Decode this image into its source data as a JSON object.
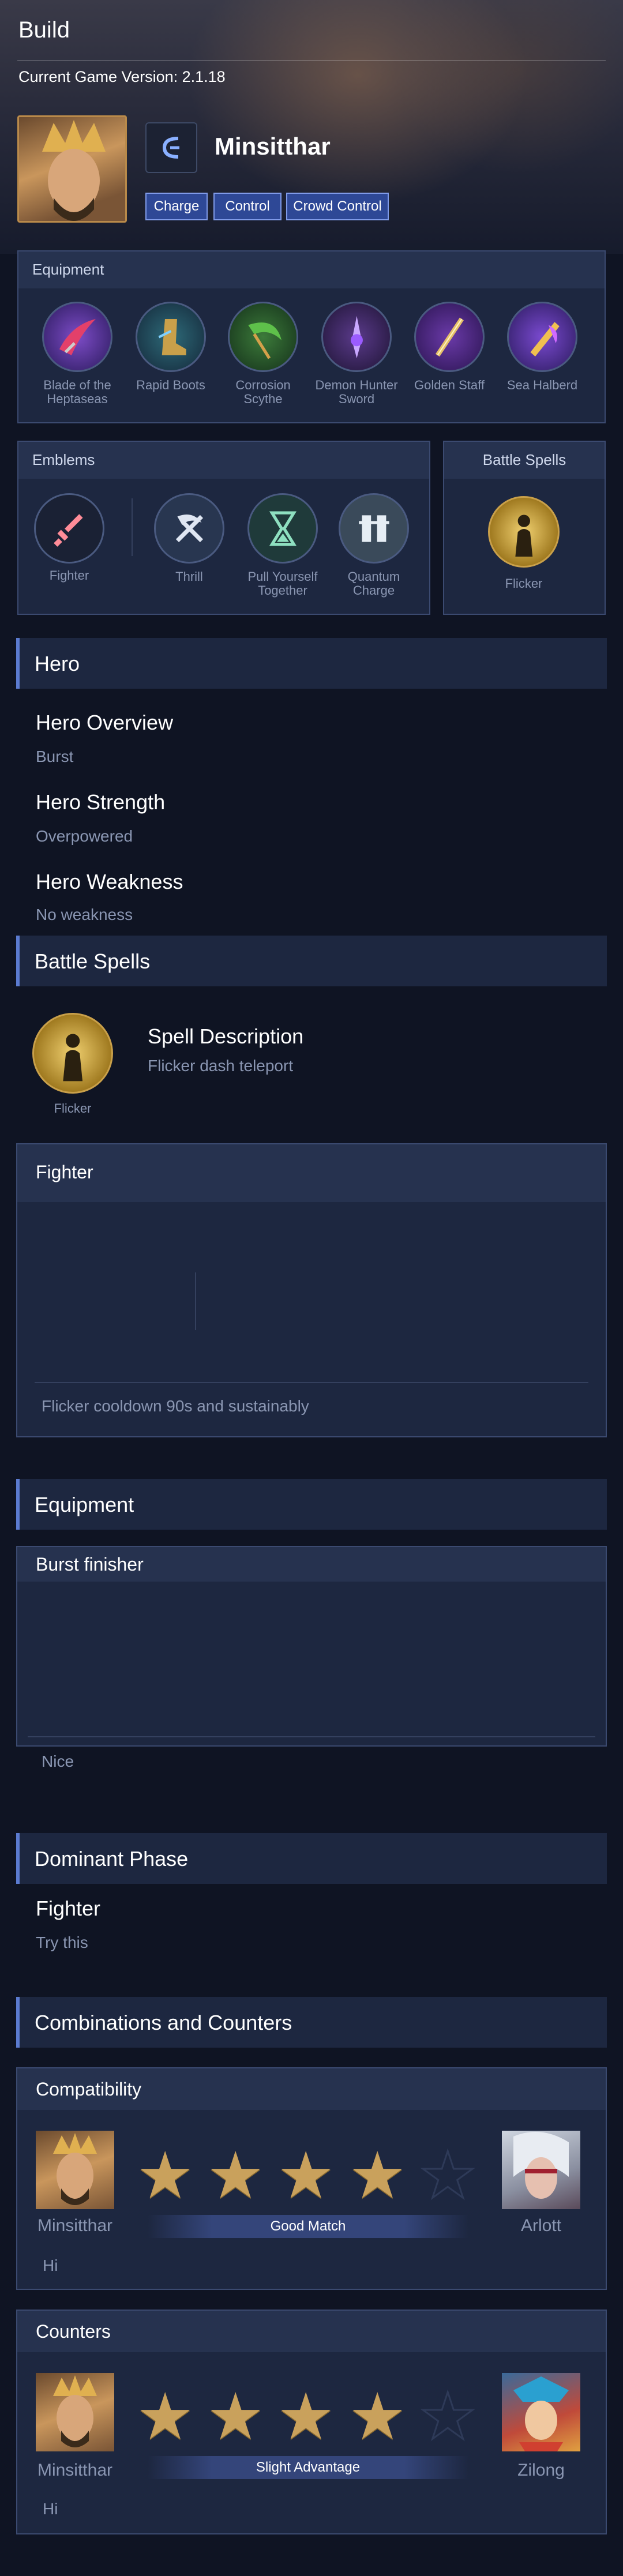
{
  "header": {
    "title": "Build",
    "version": "Current Game Version: 2.1.18"
  },
  "hero": {
    "name": "Minsitthar",
    "tags": [
      "Charge",
      "Control",
      "Crowd Control"
    ]
  },
  "equipment_panel": {
    "title": "Equipment",
    "items": [
      "Blade of the Heptaseas",
      "Rapid Boots",
      "Corrosion Scythe",
      "Demon Hunter Sword",
      "Golden Staff",
      "Sea Halberd"
    ]
  },
  "emblems_panel": {
    "title": "Emblems",
    "items": [
      "Fighter",
      "Thrill",
      "Pull Yourself Together",
      "Quantum Charge"
    ]
  },
  "spells_panel": {
    "title": "Battle Spells",
    "spell": "Flicker"
  },
  "hero_section": {
    "title": "Hero",
    "overview_title": "Hero Overview",
    "overview": "Burst",
    "strength_title": "Hero Strength",
    "strength": "Overpowered",
    "weakness_title": "Hero Weakness",
    "weakness": "No weakness"
  },
  "battle_spells_section": {
    "title": "Battle Spells",
    "spell": "Flicker",
    "desc_title": "Spell Description",
    "desc": "Flicker dash teleport"
  },
  "fighter_section": {
    "title": "Fighter",
    "items": [
      "Fighter",
      "Thrill",
      "Pull Yourself Together",
      "Quantum Charge"
    ],
    "note": "Flicker cooldown 90s and sustainably"
  },
  "equipment_section": {
    "title": "Equipment",
    "build_title": "Burst finisher",
    "items": [
      "Blade of the Heptaseas",
      "Rapid Boots",
      "Corrosion Scythe",
      "Demon Hunter Sword",
      "Golden Staff",
      "Sea Halberd"
    ],
    "note": "Nice"
  },
  "dominant_section": {
    "title": "Dominant Phase",
    "phase": "Fighter",
    "note": "Try this"
  },
  "combos_section": {
    "title": "Combinations and Counters",
    "compatibility": {
      "title": "Compatibility",
      "left": "Minsitthar",
      "right": "Arlott",
      "rating": 4,
      "max": 5,
      "label": "Good Match",
      "note": "Hi"
    },
    "counters": {
      "title": "Counters",
      "left": "Minsitthar",
      "right": "Zilong",
      "rating": 4,
      "max": 5,
      "label": "Slight Advantage",
      "note": "Hi"
    }
  },
  "colors": {
    "accent": "#5b7bd0",
    "panel": "#1d2740",
    "star": "#c9a15c",
    "tag": "#2e4896"
  }
}
